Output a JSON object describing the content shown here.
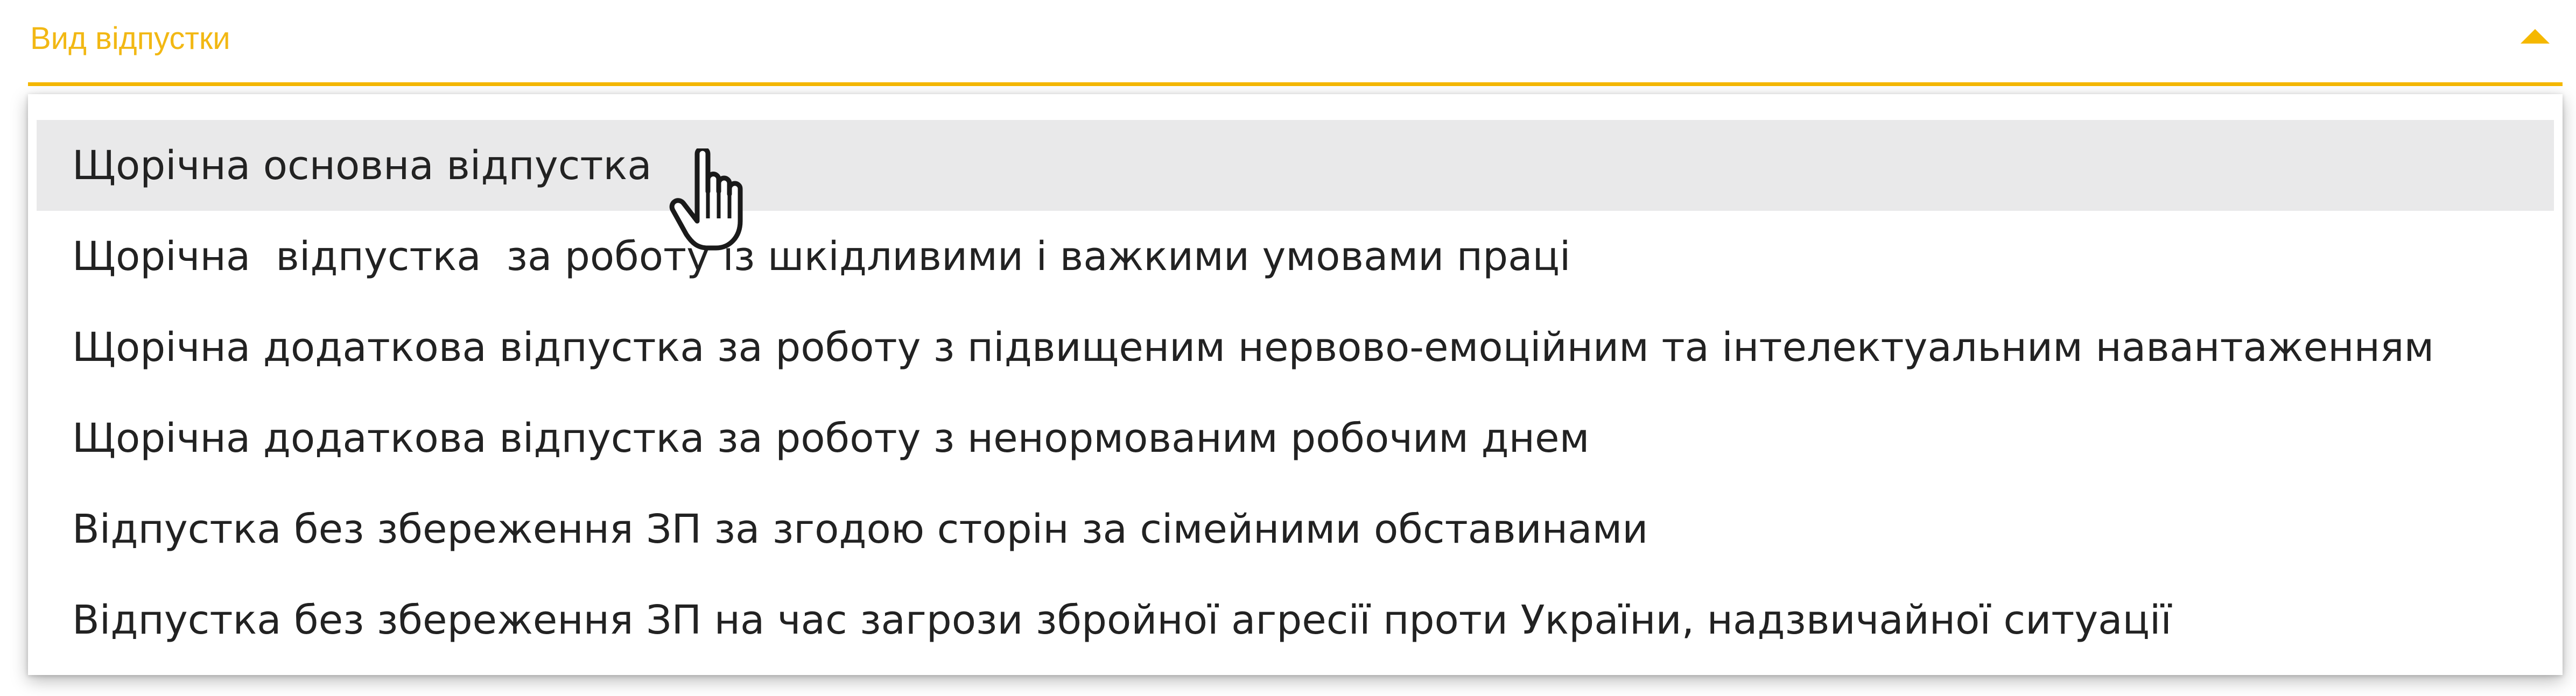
{
  "select": {
    "label": "Вид відпустки",
    "expanded": true,
    "accent_color": "#f5b800",
    "arrow_icon": "caret-up-icon"
  },
  "menu": {
    "items": [
      {
        "label": "Щорічна основна відпустка",
        "hovered": true
      },
      {
        "label": "Щорічна  відпустка  за роботу із шкідливими і важкими умовами праці"
      },
      {
        "label": "Щорічна додаткова відпустка за роботу з підвищеним нервово-емоційним та інтелектуальним навантаженням"
      },
      {
        "label": "Щорічна додаткова відпустка за роботу з ненормованим робочим днем"
      },
      {
        "label": "Відпустка без збереження ЗП за згодою сторін за сімейними обставинами"
      },
      {
        "label": "Відпустка без збереження ЗП на час загрози збройної агресії проти України, надзвичайної ситуації"
      }
    ]
  },
  "cursor": {
    "icon": "hand-pointer-icon"
  }
}
